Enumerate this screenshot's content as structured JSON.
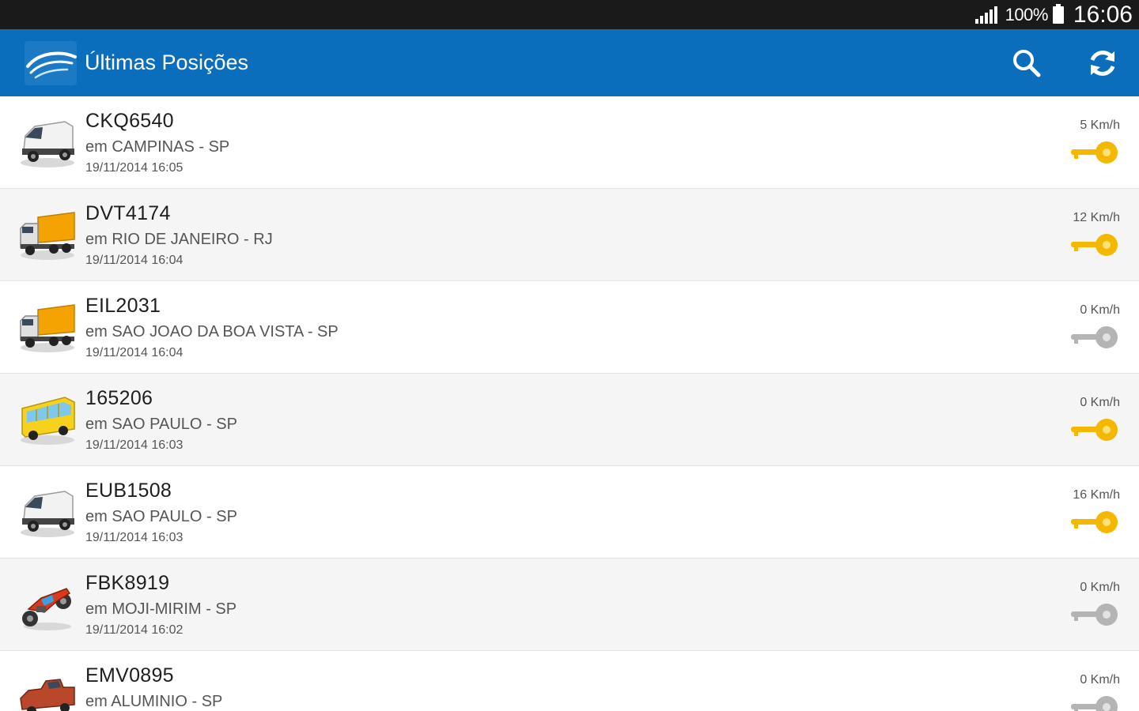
{
  "status_bar": {
    "battery": "100%",
    "time": "16:06",
    "signal_icon": "signal-icon",
    "battery_icon": "battery-icon"
  },
  "action_bar": {
    "title": "Últimas Posições",
    "logo_icon": "app-logo-icon",
    "search_icon": "search-icon",
    "refresh_icon": "refresh-icon",
    "color": "#0a6ebd"
  },
  "colors": {
    "ignition_on": "#f5b800",
    "ignition_off": "#b4b4b4"
  },
  "vehicles": [
    {
      "plate": "CKQ6540",
      "location": "em CAMPINAS - SP",
      "timestamp": "19/11/2014 16:05",
      "speed": "5 Km/h",
      "ignition": "on",
      "icon": "van-icon"
    },
    {
      "plate": "DVT4174",
      "location": "em RIO DE JANEIRO - RJ",
      "timestamp": "19/11/2014 16:04",
      "speed": "12 Km/h",
      "ignition": "on",
      "icon": "truck-icon"
    },
    {
      "plate": "EIL2031",
      "location": "em SAO JOAO DA BOA VISTA - SP",
      "timestamp": "19/11/2014 16:04",
      "speed": "0 Km/h",
      "ignition": "off",
      "icon": "truck-icon"
    },
    {
      "plate": "165206",
      "location": "em SAO PAULO - SP",
      "timestamp": "19/11/2014 16:03",
      "speed": "0 Km/h",
      "ignition": "on",
      "icon": "bus-icon"
    },
    {
      "plate": "EUB1508",
      "location": "em SAO PAULO - SP",
      "timestamp": "19/11/2014 16:03",
      "speed": "16 Km/h",
      "ignition": "on",
      "icon": "van-icon"
    },
    {
      "plate": "FBK8919",
      "location": "em MOJI-MIRIM - SP",
      "timestamp": "19/11/2014 16:02",
      "speed": "0 Km/h",
      "ignition": "off",
      "icon": "motorcycle-icon"
    },
    {
      "plate": "EMV0895",
      "location": "em ALUMINIO - SP",
      "timestamp": "",
      "speed": "0 Km/h",
      "ignition": "off",
      "icon": "pickup-icon"
    }
  ]
}
